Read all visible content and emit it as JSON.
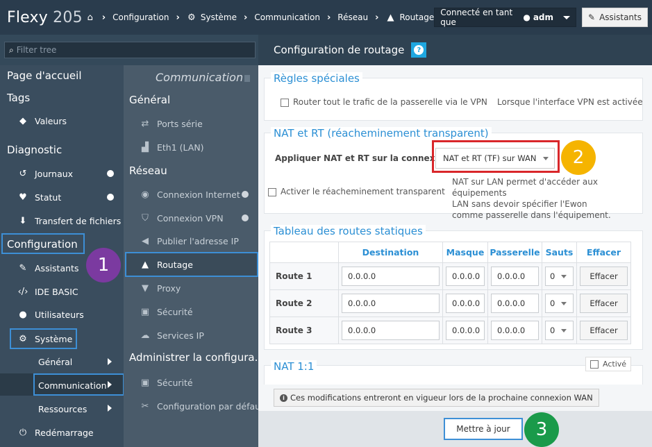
{
  "app": {
    "name": "Flexy",
    "model": "205"
  },
  "breadcrumb": [
    "Configuration",
    "Système",
    "Communication",
    "Réseau",
    "Routage"
  ],
  "user": {
    "prefix": "Connecté en tant que",
    "name": "adm"
  },
  "assistants_label": "Assistants",
  "filter": {
    "placeholder": "Filter tree"
  },
  "sidebar": {
    "home": "Page d'accueil",
    "tags": "Tags",
    "valeurs": "Valeurs",
    "diagnostic": "Diagnostic",
    "journaux": "Journaux",
    "statut": "Statut",
    "transfert": "Transfert de fichiers",
    "configuration": "Configuration",
    "assistants": "Assistants",
    "ide_basic": "IDE BASIC",
    "utilisateurs": "Utilisateurs",
    "systeme": "Système",
    "general": "Général",
    "communication": "Communication",
    "ressources": "Ressources",
    "redemarrage": "Redémarrage"
  },
  "subnav": {
    "title": "Communication",
    "general": "Général",
    "ports_serie": "Ports série",
    "eth1": "Eth1 (LAN)",
    "reseau": "Réseau",
    "connexion_internet": "Connexion Internet",
    "connexion_vpn": "Connexion VPN",
    "publier_ip": "Publier l'adresse IP",
    "routage": "Routage",
    "proxy": "Proxy",
    "securite": "Sécurité",
    "services_ip": "Services IP",
    "administrer": "Administrer la configura...",
    "securite2": "Sécurité",
    "config_defaut": "Configuration par défaut"
  },
  "page": {
    "title": "Configuration de routage"
  },
  "special_rules": {
    "legend": "Règles spéciales",
    "route_all": "Router tout le trafic de la passerelle via le VPN",
    "when_vpn": "Lorsque l'interface VPN est activée"
  },
  "nat": {
    "legend": "NAT et RT (réacheminement transparent)",
    "apply_label": "Appliquer NAT et RT sur la connexion:",
    "apply_value": "NAT et RT (TF) sur WAN",
    "transparent": "Activer le réacheminement transparent",
    "help_line1": "NAT sur LAN permet d'accéder aux équipements",
    "help_line2": "LAN  sans devoir spécifier l'Ewon",
    "help_line3": "comme passerelle dans l'équipement."
  },
  "routes": {
    "legend": "Tableau des routes statiques",
    "headers": {
      "destination": "Destination",
      "masque": "Masque",
      "passerelle": "Passerelle",
      "sauts": "Sauts",
      "effacer": "Effacer"
    },
    "rows": [
      {
        "name": "Route 1",
        "destination": "0.0.0.0",
        "masque": "0.0.0.0",
        "passerelle": "0.0.0.0",
        "sauts": "0",
        "action": "Effacer"
      },
      {
        "name": "Route 2",
        "destination": "0.0.0.0",
        "masque": "0.0.0.0",
        "passerelle": "0.0.0.0",
        "sauts": "0",
        "action": "Effacer"
      },
      {
        "name": "Route 3",
        "destination": "0.0.0.0",
        "masque": "0.0.0.0",
        "passerelle": "0.0.0.0",
        "sauts": "0",
        "action": "Effacer"
      }
    ]
  },
  "nat11": {
    "legend": "NAT 1:1",
    "active": "Activé"
  },
  "info_note": "Ces modifications entreront en vigueur lors de la prochaine connexion WAN",
  "update_button": "Mettre à jour",
  "badges": [
    "1",
    "2",
    "3"
  ],
  "colors": {
    "accent": "#2b8fd4",
    "highlight": "#3d8fd6",
    "red": "#d9262a",
    "badge1": "#7b3aa0",
    "badge2": "#f5b400",
    "badge3": "#1a9a4a"
  }
}
